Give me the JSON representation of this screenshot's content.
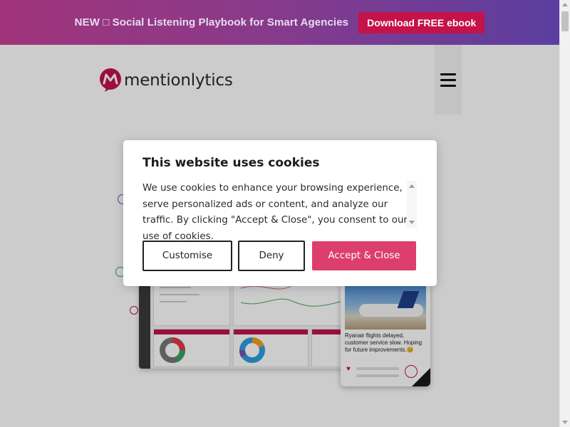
{
  "promo": {
    "text": "NEW □ Social Listening Playbook for Smart Agencies",
    "button_label": "Download FREE ebook"
  },
  "header": {
    "logo_text": "mentionlytics",
    "menu_icon": "hamburger-icon"
  },
  "hero": {
    "post_text": "Ryanair flights delayed, customer service slow. Hoping for future improvements.😊"
  },
  "cookie_modal": {
    "title": "This website uses cookies",
    "body": "We use cookies to enhance your browsing experience, serve personalized ads or content, and analyze our traffic. By clicking \"Accept & Close\", you consent to our use of cookies.",
    "buttons": {
      "customise": "Customise",
      "deny": "Deny",
      "accept": "Accept & Close"
    }
  },
  "colors": {
    "brand": "#c4124a",
    "accept": "#dc3e6e",
    "banner_start": "#a0347a",
    "banner_end": "#5b3ea0"
  }
}
